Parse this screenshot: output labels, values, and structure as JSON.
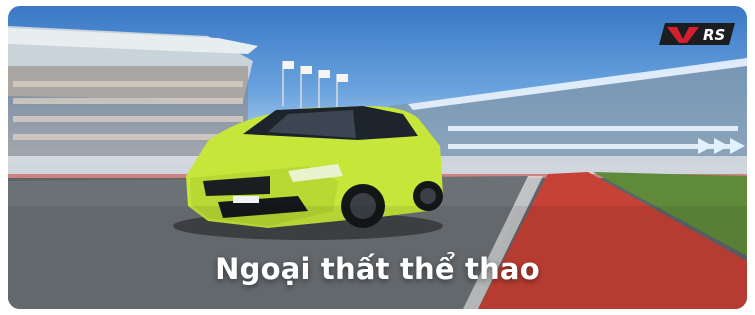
{
  "banner": {
    "title": "Ngoại thất thể thao",
    "badge_text": "RS",
    "badge_accent": "#d2202e",
    "car_color": "#c6e63a"
  }
}
